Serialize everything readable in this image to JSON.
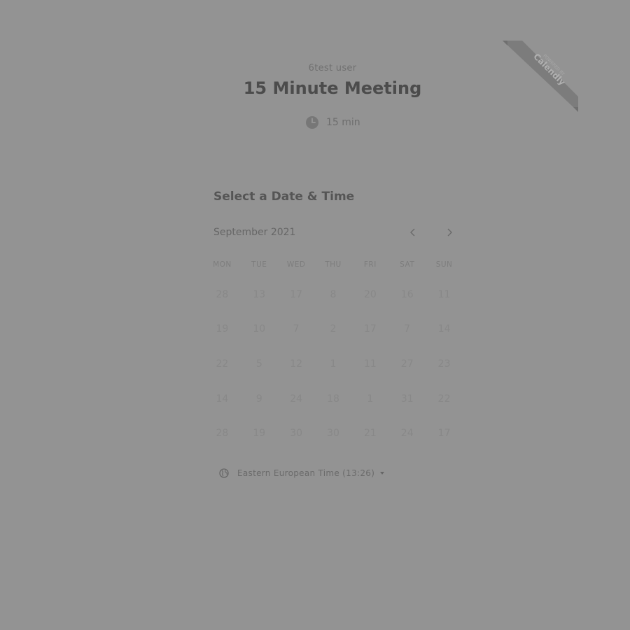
{
  "header": {
    "host_name": "6test user",
    "event_title": "15 Minute Meeting",
    "duration": "15 min",
    "duration_icon": "clock-icon"
  },
  "badge": {
    "line1": "POWERED BY",
    "line2": "Calendly"
  },
  "calendar": {
    "section_title": "Select a Date & Time",
    "month_label": "September 2021",
    "prev_icon": "chevron-left-icon",
    "next_icon": "chevron-right-icon",
    "weekdays": [
      "MON",
      "TUE",
      "WED",
      "THU",
      "FRI",
      "SAT",
      "SUN"
    ],
    "days": [
      "28",
      "13",
      "17",
      "8",
      "20",
      "16",
      "11",
      "19",
      "10",
      "7",
      "2",
      "17",
      "7",
      "14",
      "22",
      "5",
      "12",
      "1",
      "11",
      "27",
      "23",
      "14",
      "9",
      "24",
      "18",
      "1",
      "31",
      "22",
      "28",
      "19",
      "30",
      "30",
      "21",
      "24",
      "17"
    ]
  },
  "timezone": {
    "label": "Eastern European Time (13:26)",
    "icon": "globe-icon"
  },
  "colors": {
    "background": "#939393",
    "badge": "#7c7c7c"
  }
}
